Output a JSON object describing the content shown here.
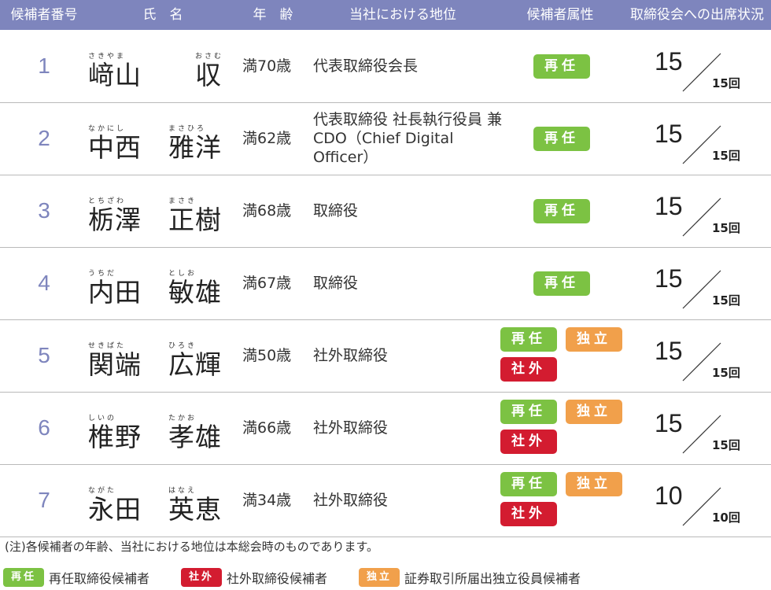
{
  "header": {
    "number": "候補者番号",
    "name": "氏　名",
    "age": "年　齢",
    "position": "当社における地位",
    "attributes": "候補者属性",
    "attendance": "取締役会への出席状況"
  },
  "badges": {
    "reelect": "再任",
    "independent": "独立",
    "outside": "社外"
  },
  "rows": [
    {
      "number": "1",
      "surname": "﨑山",
      "surname_ruby": "さきやま",
      "given": "収",
      "given_ruby": "おさむ",
      "age": "満70歳",
      "position": "代表取締役会長",
      "attended": "15",
      "total": "15回"
    },
    {
      "number": "2",
      "surname": "中西",
      "surname_ruby": "なかにし",
      "given": "雅洋",
      "given_ruby": "まさひろ",
      "age": "満62歳",
      "position": "代表取締役 社長執行役員 兼 CDO（Chief Digital Officer）",
      "attended": "15",
      "total": "15回"
    },
    {
      "number": "3",
      "surname": "栃澤",
      "surname_ruby": "とちざわ",
      "given": "正樹",
      "given_ruby": "まさき",
      "age": "満68歳",
      "position": "取締役",
      "attended": "15",
      "total": "15回"
    },
    {
      "number": "4",
      "surname": "内田",
      "surname_ruby": "うちだ",
      "given": "敏雄",
      "given_ruby": "としお",
      "age": "満67歳",
      "position": "取締役",
      "attended": "15",
      "total": "15回"
    },
    {
      "number": "5",
      "surname": "関端",
      "surname_ruby": "せきばた",
      "given": "広輝",
      "given_ruby": "ひろき",
      "age": "満50歳",
      "position": "社外取締役",
      "attended": "15",
      "total": "15回"
    },
    {
      "number": "6",
      "surname": "椎野",
      "surname_ruby": "しいの",
      "given": "孝雄",
      "given_ruby": "たかお",
      "age": "満66歳",
      "position": "社外取締役",
      "attended": "15",
      "total": "15回"
    },
    {
      "number": "7",
      "surname": "永田",
      "surname_ruby": "ながた",
      "given": "英恵",
      "given_ruby": "はなえ",
      "age": "満34歳",
      "position": "社外取締役",
      "attended": "10",
      "total": "10回"
    }
  ],
  "note": "(注)各候補者の年齢、当社における地位は本総会時のものであります。",
  "legend": {
    "reelect": "再任取締役候補者",
    "outside": "社外取締役候補者",
    "independent": "証券取引所届出独立役員候補者"
  },
  "colors": {
    "header": "#7e85bd",
    "number": "#7e85bd",
    "reelect": "#7cc243",
    "independent": "#f1a04b",
    "outside": "#d31c30"
  }
}
